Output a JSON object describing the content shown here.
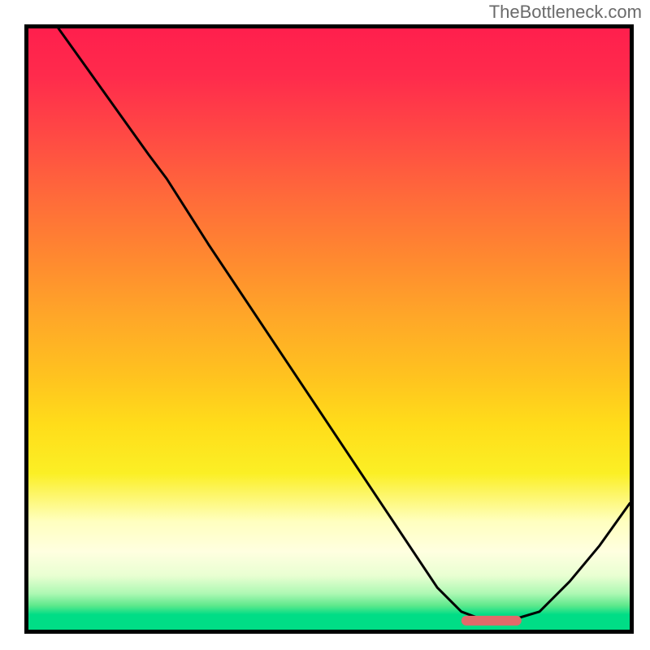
{
  "attribution": "TheBottleneck.com",
  "colors": {
    "border": "#000000",
    "curve": "#000000",
    "marker": "#e26a6a",
    "gradient_top": "#ff1f4d",
    "gradient_mid": "#ffdd1a",
    "gradient_bottom": "#00dd86"
  },
  "chart_data": {
    "type": "line",
    "title": "",
    "xlabel": "",
    "ylabel": "",
    "xlim": [
      0,
      100
    ],
    "ylim": [
      0,
      100
    ],
    "x": [
      5,
      10,
      15,
      20,
      23,
      30,
      40,
      50,
      60,
      68,
      72,
      76,
      80,
      85,
      90,
      95,
      100
    ],
    "values": [
      100,
      93,
      86,
      79,
      75,
      64,
      49,
      34,
      19,
      7,
      3,
      1.5,
      1.5,
      3,
      8,
      14,
      21
    ],
    "marker": {
      "x_start": 72,
      "x_end": 82,
      "y": 1.5
    },
    "annotations": []
  }
}
